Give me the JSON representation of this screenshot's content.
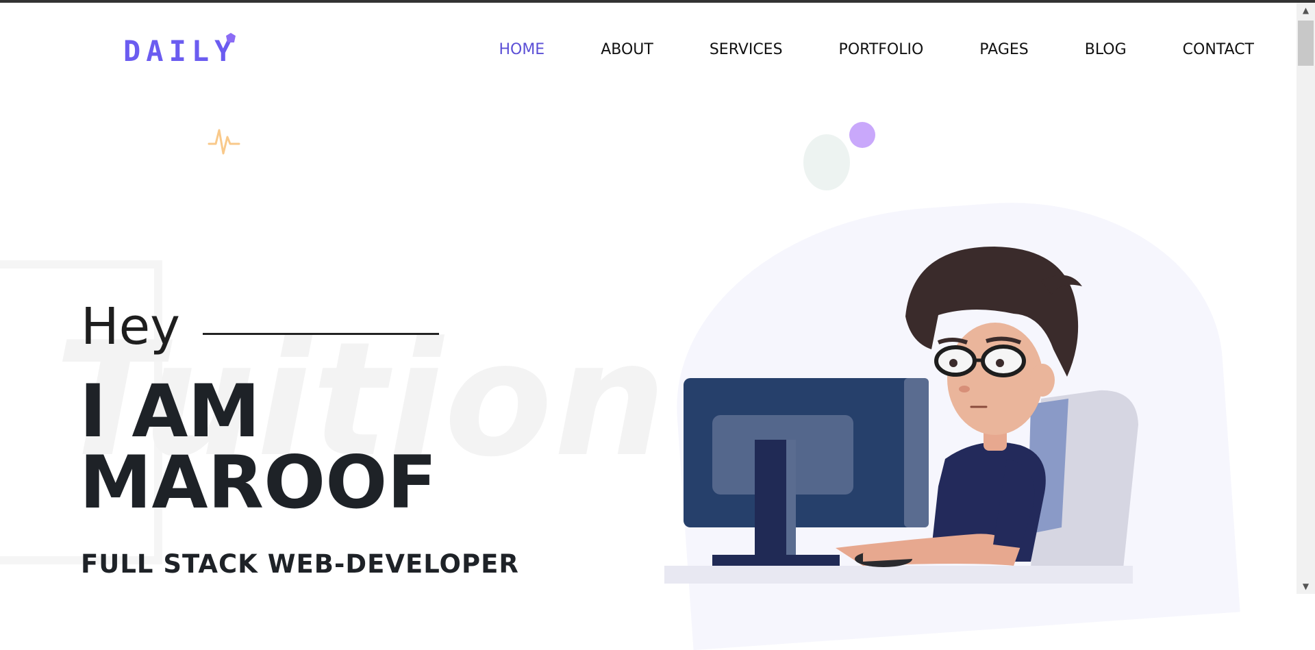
{
  "header": {
    "logo": "DAILY",
    "nav": [
      {
        "label": "HOME",
        "active": true
      },
      {
        "label": "ABOUT",
        "active": false
      },
      {
        "label": "SERVICES",
        "active": false
      },
      {
        "label": "PORTFOLIO",
        "active": false
      },
      {
        "label": "PAGES",
        "active": false
      },
      {
        "label": "BLOG",
        "active": false
      },
      {
        "label": "CONTACT",
        "active": false
      }
    ]
  },
  "hero": {
    "watermark": "Tuition",
    "greeting": "Hey",
    "line1": "I AM",
    "line2": "MAROOF",
    "role": "FULL STACK WEB-DEVELOPER"
  },
  "colors": {
    "accent": "#5b4fd6",
    "text": "#1e2227",
    "blob": "#f6f6fd",
    "purple_dot": "#c9a8fb",
    "pulse": "#f9c98a"
  },
  "icons": {
    "scroll_up": "▲",
    "scroll_down": "▼"
  }
}
